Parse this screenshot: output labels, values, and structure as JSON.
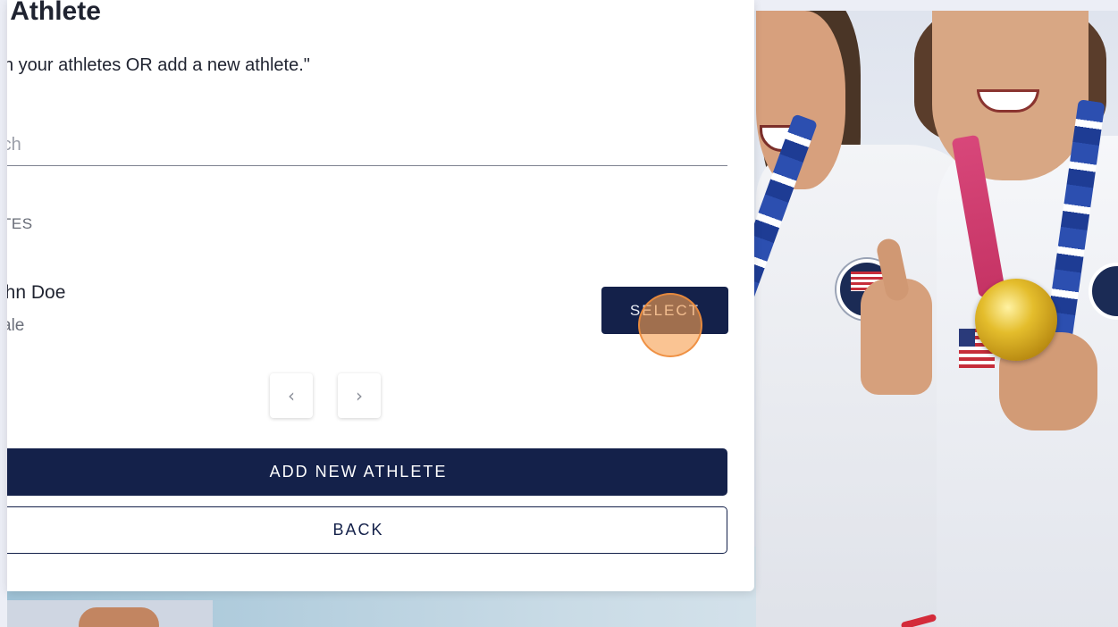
{
  "dialog": {
    "title": "t Athlete",
    "subtitle": "n your athletes OR add a new athlete.\"",
    "search": {
      "placeholder": "rch",
      "value": ""
    },
    "section_label": "TES",
    "athlete": {
      "name": "ohn Doe",
      "gender": "ale"
    },
    "select_label": "SELECT",
    "pager": {
      "prev_icon": "chevron-left-icon",
      "prev_glyph": "‹",
      "next_icon": "chevron-right-icon",
      "next_glyph": "›"
    },
    "add_label": "ADD NEW ATHLETE",
    "back_label": "BACK"
  },
  "colors": {
    "primary": "#14214a",
    "card": "#ffffff",
    "page_bg": "#eceef6",
    "click_marker": "#f7a050"
  }
}
